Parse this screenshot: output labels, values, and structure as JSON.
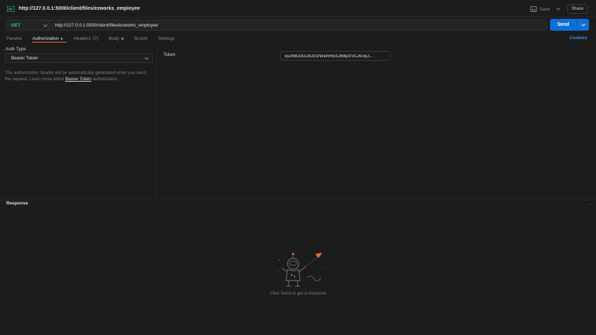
{
  "request": {
    "title": "http://127.0.0.1:5000/client/files/ezworks_employee",
    "method": "GET",
    "url": "http://127.0.0.1:5000/client/files/ezworks_employee"
  },
  "toolbar": {
    "save_label": "Save",
    "share_label": "Share",
    "send_label": "Send"
  },
  "tabs": [
    {
      "label": "Params",
      "active": false
    },
    {
      "label": "Authorization",
      "active": true,
      "dot": true
    },
    {
      "label": "Headers",
      "count": "(7)",
      "active": false
    },
    {
      "label": "Body",
      "active": false,
      "dot": true
    },
    {
      "label": "Scripts",
      "active": false
    },
    {
      "label": "Settings",
      "active": false
    }
  ],
  "cookies_label": "Cookies",
  "auth": {
    "type_label": "Auth Type",
    "selected_type": "Bearer Token",
    "description_pre": "The authorization header will be automatically generated when you send the request. Learn more about ",
    "description_link": "Bearer Token",
    "description_post": " authorization.",
    "token_label": "Token",
    "token_value": "eyJhbGciOiJIUzI1NiIsInR5cCI6IkpXVCJ9.eyJ..."
  },
  "response": {
    "title": "Response",
    "more": "...",
    "empty_message": "Click Send to get a response"
  },
  "colors": {
    "background": "#1c1c1c",
    "accent_orange": "#f2683a",
    "send_blue": "#0d6fd6",
    "method_green": "#2fc98f",
    "link_blue": "#3b8fe8"
  }
}
